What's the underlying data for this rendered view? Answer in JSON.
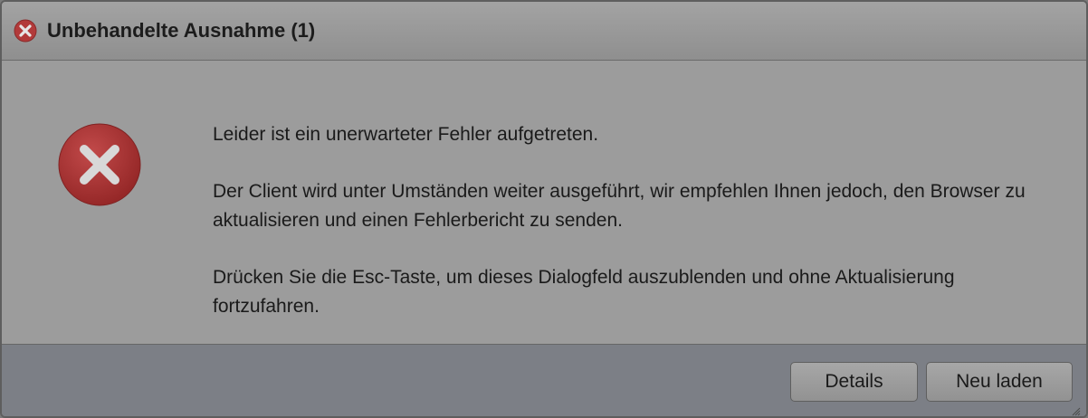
{
  "dialog": {
    "title": "Unbehandelte Ausnahme (1)",
    "title_icon": "error-circle-icon",
    "main_icon": "error-circle-icon",
    "messages": [
      "Leider ist ein unerwarteter Fehler aufgetreten.",
      "Der Client wird unter Umständen weiter ausgeführt, wir empfehlen Ihnen jedoch, den Browser zu aktualisieren und einen Fehlerbericht zu senden.",
      "Drücken Sie die Esc-Taste, um dieses Dialogfeld auszublenden und ohne Aktualisierung fortzufahren."
    ],
    "buttons": {
      "details_label": "Details",
      "reload_label": "Neu laden"
    },
    "colors": {
      "error_red": "#b8393a",
      "overlay_gray": "#9c9c9c"
    }
  }
}
